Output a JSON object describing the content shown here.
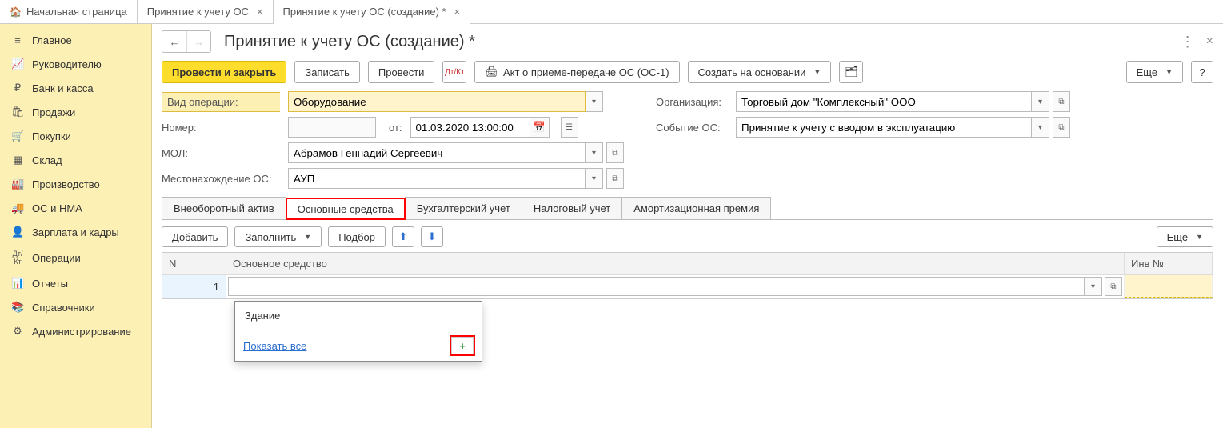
{
  "tabs": {
    "home": "Начальная страница",
    "t1": "Принятие к учету ОС",
    "t2": "Принятие к учету ОС (создание) *"
  },
  "sidebar": {
    "items": [
      {
        "icon": "≡",
        "label": "Главное"
      },
      {
        "icon": "📈",
        "label": "Руководителю"
      },
      {
        "icon": "₽",
        "label": "Банк и касса"
      },
      {
        "icon": "🛍",
        "label": "Продажи"
      },
      {
        "icon": "🛒",
        "label": "Покупки"
      },
      {
        "icon": "▦",
        "label": "Склад"
      },
      {
        "icon": "🏭",
        "label": "Производство"
      },
      {
        "icon": "🚚",
        "label": "ОС и НМА"
      },
      {
        "icon": "👤",
        "label": "Зарплата и кадры"
      },
      {
        "icon": "Дт/Кт",
        "label": "Операции"
      },
      {
        "icon": "📊",
        "label": "Отчеты"
      },
      {
        "icon": "📚",
        "label": "Справочники"
      },
      {
        "icon": "⚙",
        "label": "Администрирование"
      }
    ]
  },
  "title": "Принятие к учету ОС (создание) *",
  "commands": {
    "post_close": "Провести и закрыть",
    "write": "Записать",
    "post": "Провести",
    "dtkt": "Дт/Кт",
    "print_act": "Акт о приеме-передаче ОС (ОС-1)",
    "create_based": "Создать на основании",
    "more": "Еще",
    "help": "?"
  },
  "form": {
    "op_type_label": "Вид операции:",
    "op_type_value": "Оборудование",
    "number_label": "Номер:",
    "number_value": "",
    "from_label": "от:",
    "date_value": "01.03.2020 13:00:00",
    "mol_label": "МОЛ:",
    "mol_value": "Абрамов Геннадий Сергеевич",
    "location_label": "Местонахождение ОС:",
    "location_value": "АУП",
    "org_label": "Организация:",
    "org_value": "Торговый дом \"Комплексный\" ООО",
    "event_label": "Событие ОС:",
    "event_value": "Принятие к учету с вводом в эксплуатацию"
  },
  "subtabs": {
    "t0": "Внеоборотный актив",
    "t1": "Основные средства",
    "t2": "Бухгалтерский учет",
    "t3": "Налоговый учет",
    "t4": "Амортизационная премия"
  },
  "tblbar": {
    "add": "Добавить",
    "fill": "Заполнить",
    "pick": "Подбор",
    "more": "Еще"
  },
  "table": {
    "col_n": "N",
    "col_os": "Основное средство",
    "col_inv": "Инв №",
    "rows": [
      {
        "n": "1",
        "os": "",
        "inv": ""
      }
    ]
  },
  "dropdown": {
    "item0": "Здание",
    "show_all": "Показать все",
    "plus": "+"
  }
}
